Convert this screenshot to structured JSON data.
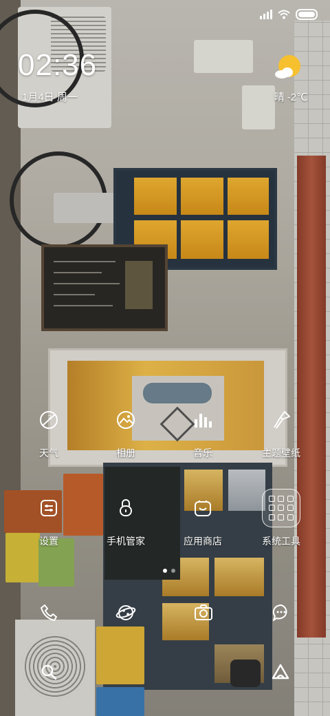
{
  "status": {
    "signal_bars": 4,
    "wifi": "wifi-icon",
    "battery": "battery-icon"
  },
  "clock_widget": {
    "time": "02:36",
    "date": "1月4日 周一",
    "weather": "晴 -2℃",
    "weather_icon": "sun-cloud-icon"
  },
  "apps": {
    "row1": [
      {
        "label": "天气",
        "icon": "weather-icon"
      },
      {
        "label": "相册",
        "icon": "gallery-icon"
      },
      {
        "label": "音乐",
        "icon": "music-icon"
      },
      {
        "label": "主题壁纸",
        "icon": "themes-icon"
      }
    ],
    "row2": [
      {
        "label": "设置",
        "icon": "settings-icon"
      },
      {
        "label": "手机管家",
        "icon": "security-icon"
      },
      {
        "label": "应用商店",
        "icon": "app-store-icon"
      },
      {
        "label": "系统工具",
        "icon": "folder-icon"
      }
    ]
  },
  "page_indicator": {
    "pages": 2,
    "current": 1
  },
  "dock": [
    {
      "icon": "phone-icon"
    },
    {
      "icon": "browser-icon"
    },
    {
      "icon": "camera-icon"
    },
    {
      "icon": "messages-icon"
    }
  ],
  "bottom_actions": [
    {
      "icon": "search-icon"
    },
    {
      "icon": "assistant-icon"
    }
  ]
}
